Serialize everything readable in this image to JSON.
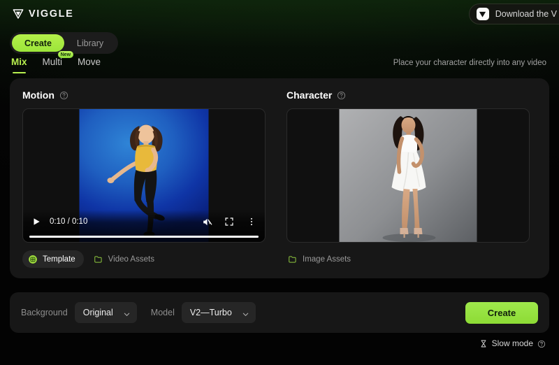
{
  "brand": {
    "name": "VIGGLE",
    "logo_icon": "viggle-v-mark"
  },
  "header": {
    "download_button": {
      "label": "Download the V",
      "icon": "viggle-app-icon"
    }
  },
  "segmented": {
    "items": [
      {
        "label": "Create",
        "active": true
      },
      {
        "label": "Library",
        "active": false
      }
    ]
  },
  "tabs": {
    "items": [
      {
        "label": "Mix",
        "active": true,
        "badge": ""
      },
      {
        "label": "Multi",
        "active": false,
        "badge": "New"
      },
      {
        "label": "Move",
        "active": false,
        "badge": ""
      }
    ],
    "tagline": "Place your character directly into any video"
  },
  "motion": {
    "title": "Motion",
    "help_icon": "question-circle-icon",
    "video": {
      "play_icon": "play-icon",
      "time": "0:10 / 0:10",
      "mute_icon": "volume-muted-icon",
      "fullscreen_icon": "fullscreen-icon",
      "more_icon": "more-vertical-icon",
      "progress_percent": 100
    },
    "actions": [
      {
        "label": "Template",
        "icon": "template-grid-icon",
        "selected": true
      },
      {
        "label": "Video Assets",
        "icon": "folder-icon",
        "selected": false
      }
    ]
  },
  "character": {
    "title": "Character",
    "help_icon": "question-circle-icon",
    "actions": [
      {
        "label": "Image Assets",
        "icon": "folder-icon",
        "selected": false
      }
    ]
  },
  "controls": {
    "background_label": "Background",
    "background_value": "Original",
    "model_label": "Model",
    "model_value": "V2—Turbo",
    "caret_icon": "chevron-down-icon",
    "create_label": "Create"
  },
  "footer": {
    "slow_mode_label": "Slow mode",
    "slow_mode_icon": "hourglass-icon",
    "slow_mode_help_icon": "question-circle-icon"
  },
  "colors": {
    "accent_green": "#9ce53a",
    "card_bg": "#171717",
    "page_bg": "#030303"
  }
}
